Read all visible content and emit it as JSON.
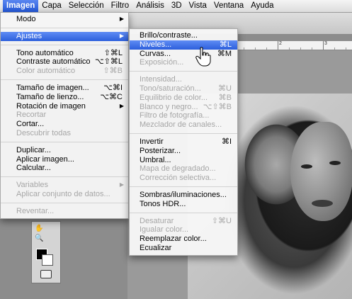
{
  "menubar": {
    "items": [
      "Imagen",
      "Capa",
      "Selección",
      "Filtro",
      "Análisis",
      "3D",
      "Vista",
      "Ventana",
      "Ayuda"
    ]
  },
  "ruler": {
    "labels": [
      "2",
      "3"
    ]
  },
  "imagen_menu": {
    "modo": "Modo",
    "ajustes": "Ajustes",
    "tono_auto": "Tono automático",
    "tono_auto_sc": "⇧⌘L",
    "contraste_auto": "Contraste automático",
    "contraste_auto_sc": "⌥⇧⌘L",
    "color_auto": "Color automático",
    "color_auto_sc": "⇧⌘B",
    "tamano_imagen": "Tamaño de imagen...",
    "tamano_imagen_sc": "⌥⌘I",
    "tamano_lienzo": "Tamaño de lienzo...",
    "tamano_lienzo_sc": "⌥⌘C",
    "rotacion": "Rotación de imagen",
    "recortar": "Recortar",
    "cortar": "Cortar...",
    "descubrir": "Descubrir todas",
    "duplicar": "Duplicar...",
    "aplicar_imagen": "Aplicar imagen...",
    "calcular": "Calcular...",
    "variables": "Variables",
    "aplicar_conjunto": "Aplicar conjunto de datos...",
    "reventar": "Reventar..."
  },
  "ajustes_menu": {
    "brillo": "Brillo/contraste...",
    "niveles": "Niveles...",
    "niveles_sc": "⌘L",
    "curvas": "Curvas...",
    "curvas_sc": "⌘M",
    "exposicion": "Exposición...",
    "intensidad": "Intensidad...",
    "tono_sat": "Tono/saturación...",
    "tono_sat_sc": "⌘U",
    "equilibrio": "Equilibrio de color...",
    "equilibrio_sc": "⌘B",
    "blanco_negro": "Blanco y negro...",
    "blanco_negro_sc": "⌥⇧⌘B",
    "filtro_foto": "Filtro de fotografía...",
    "mezclador": "Mezclador de canales...",
    "invertir": "Invertir",
    "invertir_sc": "⌘I",
    "posterizar": "Posterizar...",
    "umbral": "Umbral...",
    "mapa_degradado": "Mapa de degradado...",
    "correccion": "Corrección selectiva...",
    "sombras": "Sombras/iluminaciones...",
    "tonos_hdr": "Tonos HDR...",
    "desaturar": "Desaturar",
    "desaturar_sc": "⇧⌘U",
    "igualar": "Igualar color...",
    "reemplazar": "Reemplazar color...",
    "ecualizar": "Ecualizar"
  },
  "colors": {
    "highlight": "#2c5fdc",
    "disabled": "#a6a6a6"
  }
}
